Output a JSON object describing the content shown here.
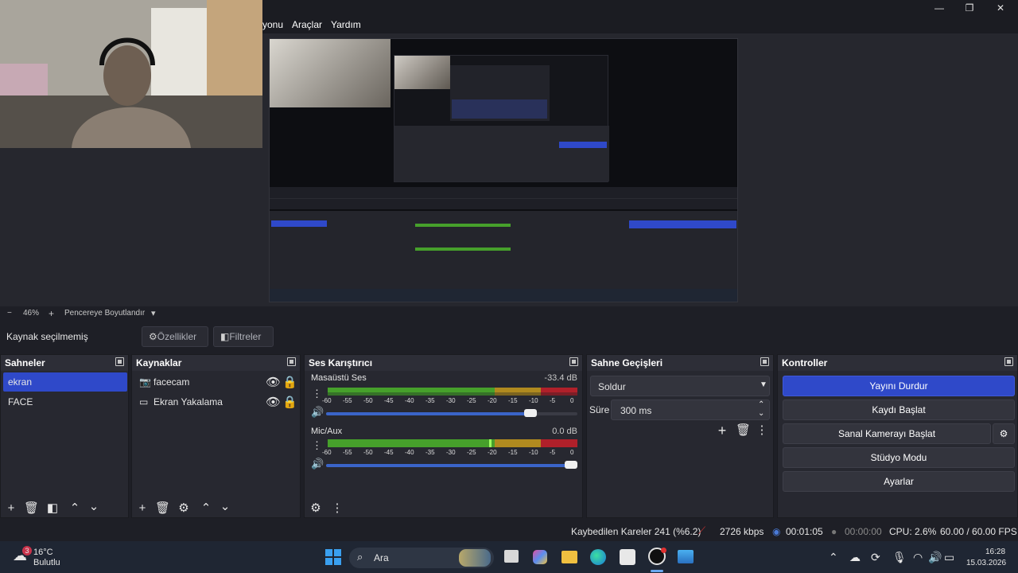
{
  "menu": {
    "items": [
      "yonu",
      "Araçlar",
      "Yardım"
    ]
  },
  "window": {
    "minimize": "—",
    "maximize": "❐",
    "close": "✕"
  },
  "zoom": {
    "minus": "−",
    "value": "46%",
    "plus": "+",
    "fit_label": "Pencereye Boyutlandır",
    "dropdown": "▾"
  },
  "source_toolbar": {
    "no_source": "Kaynak seçilmemiş",
    "properties": "Özellikler",
    "filters": "Filtreler"
  },
  "scenes": {
    "title": "Sahneler",
    "items": [
      "ekran",
      "FACE"
    ]
  },
  "sources": {
    "title": "Kaynaklar",
    "items": [
      {
        "name": "facecam",
        "type": "camera"
      },
      {
        "name": "Ekran Yakalama",
        "type": "monitor"
      }
    ]
  },
  "mixer": {
    "title": "Ses Karıştırıcı",
    "channels": [
      {
        "name": "Masaüstü Ses",
        "db": "-33.4 dB",
        "volume": 0.83,
        "level": 0.33
      },
      {
        "name": "Mic/Aux",
        "db": "0.0 dB",
        "volume": 1.0,
        "level": 0.65
      }
    ],
    "scale": [
      "-60",
      "-55",
      "-50",
      "-45",
      "-40",
      "-35",
      "-30",
      "-25",
      "-20",
      "-15",
      "-10",
      "-5",
      "0"
    ]
  },
  "transitions": {
    "title": "Sahne Geçişleri",
    "selected": "Soldur",
    "duration_label": "Süre",
    "duration_value": "300 ms"
  },
  "controls": {
    "title": "Kontroller",
    "stop_stream": "Yayını Durdur",
    "start_record": "Kaydı Başlat",
    "start_virtualcam": "Sanal Kamerayı Başlat",
    "studio_mode": "Stüdyo Modu",
    "settings": "Ayarlar"
  },
  "status": {
    "dropped": "Kaybedilen Kareler 241 (%6.2)",
    "bitrate": "2726 kbps",
    "stream_time": "00:01:05",
    "record_time": "00:00:00",
    "cpu": "CPU: 2.6%",
    "fps": "60.00 / 60.00 FPS"
  },
  "taskbar": {
    "weather_temp": "16°C",
    "weather_desc": "Bulutlu",
    "weather_badge": "3",
    "search": "Ara",
    "time": "16:28",
    "date": "15.03.2026"
  },
  "colors": {
    "accent": "#2f49c9",
    "meter_green": "#46a02b",
    "meter_yellow": "#b08a1f",
    "meter_red": "#b0202a",
    "slider": "#3a64c8"
  }
}
